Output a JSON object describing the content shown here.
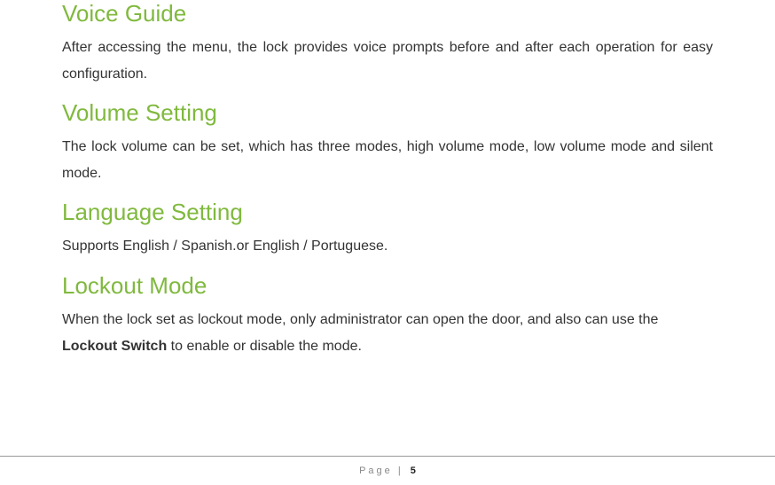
{
  "sections": [
    {
      "title": "Voice Guide",
      "body": "After accessing the menu, the lock provides voice prompts before and after each operation for easy configuration.",
      "justify": true
    },
    {
      "title": "Volume Setting",
      "body": "The lock volume can be set, which has three modes, high volume mode, low volume mode and silent mode.",
      "justify": true
    },
    {
      "title": "Language Setting",
      "body": "Supports English / Spanish.or English / Portuguese.",
      "justify": false
    },
    {
      "title": "Lockout Mode",
      "body_pre": "When the lock set as lockout mode, only administrator can open the door, and also can use the ",
      "body_bold": "Lockout Switch",
      "body_post": " to enable or disable the mode.",
      "justify": false
    }
  ],
  "footer": {
    "page_label": "Page",
    "page_sep": " | ",
    "page_num": "5"
  }
}
